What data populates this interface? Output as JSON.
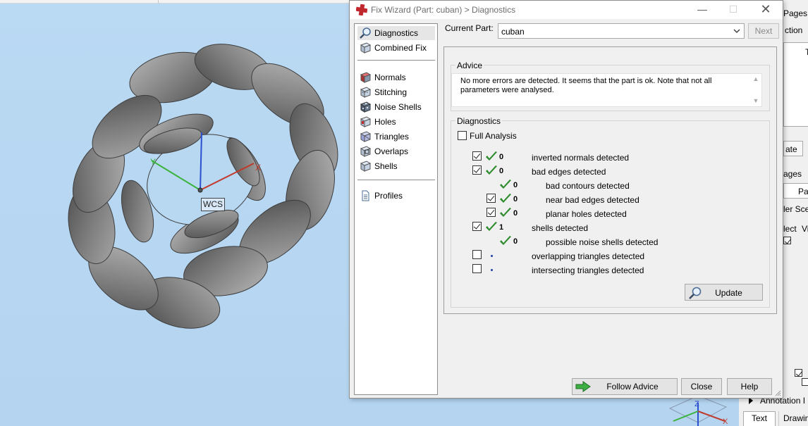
{
  "viewport": {
    "wcs_label": "WCS",
    "axis_labels": {
      "x": "X",
      "y": "Y",
      "z": "Z"
    }
  },
  "dialog": {
    "title": "Fix Wizard (Part: cuban) > Diagnostics",
    "nav": {
      "items": [
        {
          "label": "Diagnostics",
          "icon": "magnifier-icon",
          "selected": true
        },
        {
          "label": "Combined Fix",
          "icon": "cube-icon"
        },
        {
          "label": "Normals",
          "icon": "normals-cube-icon"
        },
        {
          "label": "Stitching",
          "icon": "stitching-cube-icon"
        },
        {
          "label": "Noise Shells",
          "icon": "noise-shells-icon"
        },
        {
          "label": "Holes",
          "icon": "holes-cube-icon"
        },
        {
          "label": "Triangles",
          "icon": "triangles-cube-icon"
        },
        {
          "label": "Overlaps",
          "icon": "overlaps-cube-icon"
        },
        {
          "label": "Shells",
          "icon": "shells-cube-icon"
        },
        {
          "label": "Profiles",
          "icon": "document-icon"
        }
      ]
    },
    "current_part_label": "Current Part:",
    "current_part_value": "cuban",
    "next_label": "Next",
    "advice": {
      "title": "Advice",
      "text": "No more errors are detected. It seems that the part is ok. Note that not all parameters were analysed."
    },
    "diagnostics": {
      "title": "Diagnostics",
      "full_analysis_label": "Full Analysis",
      "full_analysis_checked": false,
      "rows": [
        {
          "checked": true,
          "status": "ok",
          "count": "0",
          "label": "inverted normals detected",
          "indent": 0
        },
        {
          "checked": true,
          "status": "ok",
          "count": "0",
          "label": "bad edges detected",
          "indent": 0
        },
        {
          "checked": null,
          "status": "ok",
          "count": "0",
          "label": "bad contours detected",
          "indent": 1
        },
        {
          "checked": true,
          "status": "ok",
          "count": "0",
          "label": "near bad edges detected",
          "indent": 1
        },
        {
          "checked": true,
          "status": "ok",
          "count": "0",
          "label": "planar holes detected",
          "indent": 1
        },
        {
          "checked": true,
          "status": "ok",
          "count": "1",
          "label": "shells detected",
          "indent": 0
        },
        {
          "checked": null,
          "status": "ok",
          "count": "0",
          "label": "possible noise shells detected",
          "indent": 1
        },
        {
          "checked": false,
          "status": "none",
          "count": "",
          "label": "overlapping triangles detected",
          "indent": 0
        },
        {
          "checked": false,
          "status": "none",
          "count": "",
          "label": "intersecting triangles detected",
          "indent": 0
        }
      ],
      "update_label": "Update"
    },
    "buttons": {
      "follow_advice": "Follow Advice",
      "close": "Close",
      "help": "Help"
    }
  },
  "right_panel": {
    "fragments": [
      "Pages",
      "ction",
      "T",
      "ate",
      "ages",
      "Par",
      "ler Sce",
      "lect",
      "Vi"
    ],
    "annotation_label": "Annotation I",
    "tab_text": "Text",
    "tab_drawing": "Drawin"
  },
  "colors": {
    "viewport_bg": "#b8d8f2",
    "ok_check": "#2e8b2e",
    "link_dot": "#1d3fa8",
    "axis_x": "#c0392b",
    "axis_y": "#3bb33b",
    "axis_z": "#2b4fd0"
  }
}
